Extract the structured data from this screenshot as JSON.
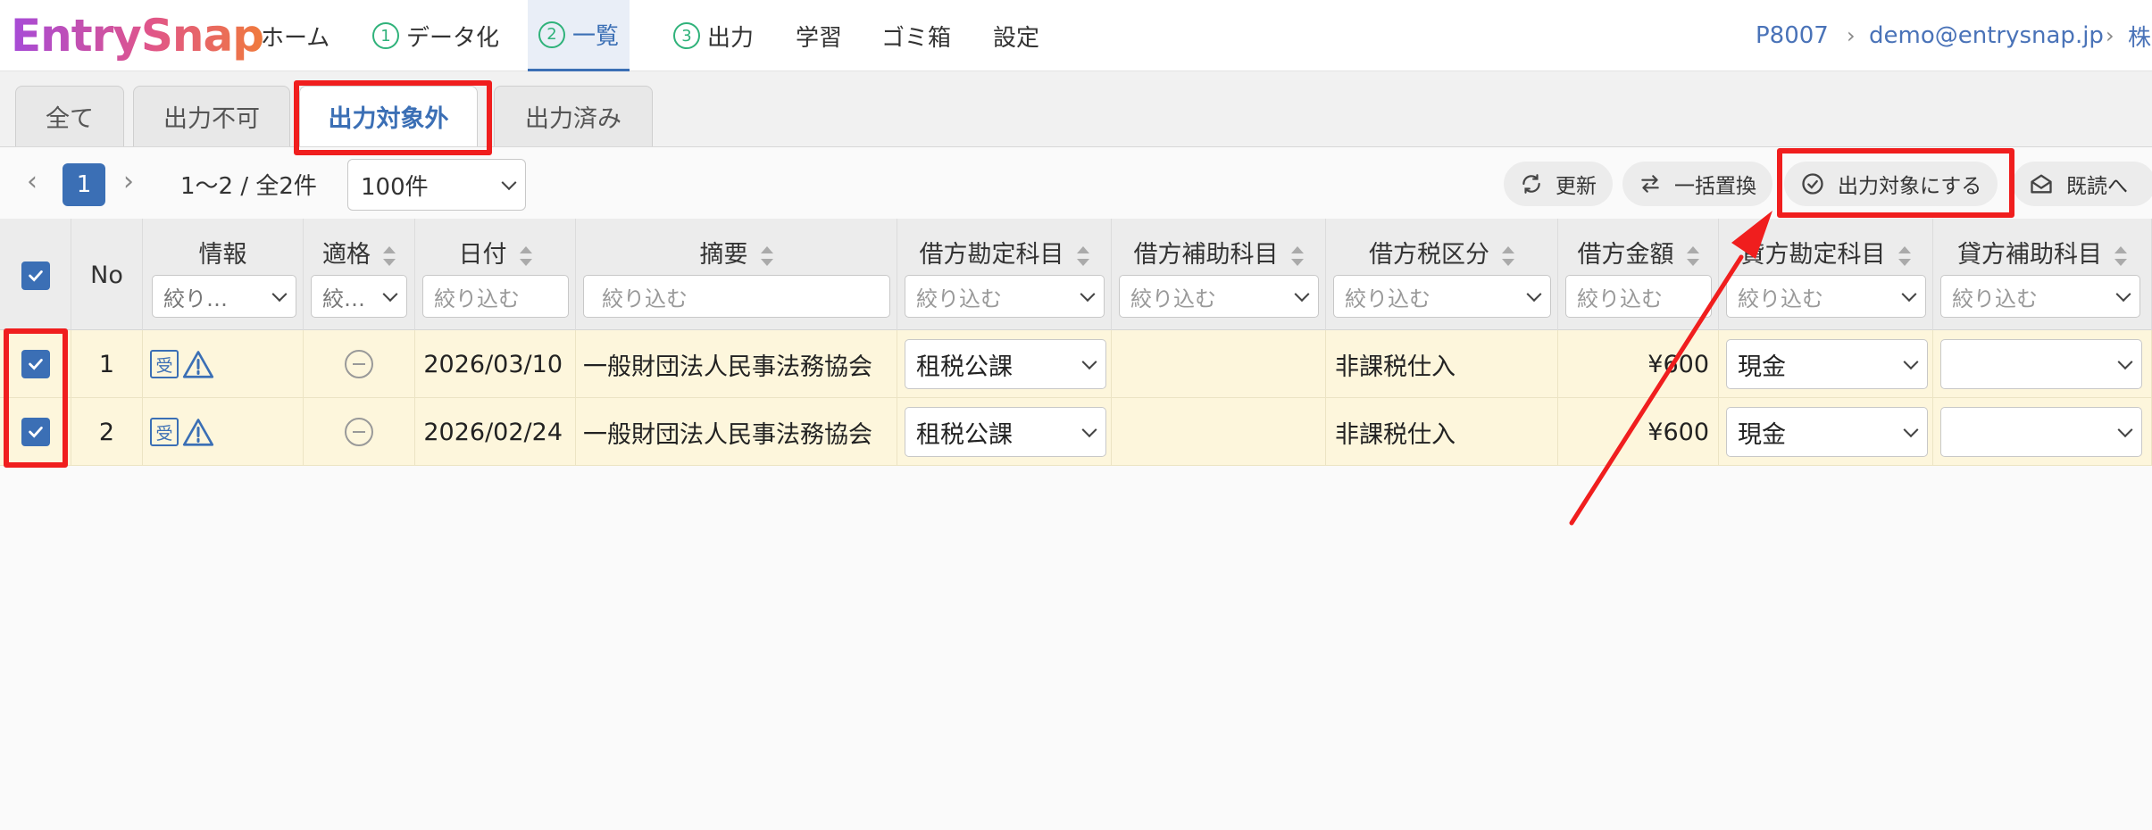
{
  "header": {
    "logo": "EntrySnap",
    "nav": [
      {
        "label": "ホーム",
        "step": ""
      },
      {
        "label": "データ化",
        "step": "1"
      },
      {
        "label": "一覧",
        "step": "2",
        "active": true
      },
      {
        "label": "出力",
        "step": "3"
      },
      {
        "label": "学習",
        "step": ""
      },
      {
        "label": "ゴミ箱",
        "step": ""
      },
      {
        "label": "設定",
        "step": ""
      }
    ],
    "breadcrumb": [
      "P8007",
      "demo@entrysnap.jp",
      "株"
    ]
  },
  "tabs": [
    {
      "label": "全て"
    },
    {
      "label": "出力不可"
    },
    {
      "label": "出力対象外",
      "active": true
    },
    {
      "label": "出力済み"
    }
  ],
  "toolbar": {
    "current_page": "1",
    "range": "1〜2 / 全2件",
    "per_page": "100件",
    "buttons": {
      "refresh": "更新",
      "bulk_replace": "一括置換",
      "mark_output": "出力対象にする",
      "mark_read": "既読へ"
    }
  },
  "table": {
    "columns": {
      "no": "No",
      "info": "情報",
      "eligible": "適格",
      "date": "日付",
      "summary": "摘要",
      "debit_account": "借方勘定科目",
      "debit_sub": "借方補助科目",
      "debit_tax": "借方税区分",
      "debit_amount": "借方金額",
      "credit_account": "貸方勘定科目",
      "credit_sub": "貸方補助科目"
    },
    "filter_placeholder": "絞り込む",
    "filter_short_info": "絞り…",
    "filter_short_eligible": "絞…",
    "rows": [
      {
        "no": "1",
        "badge": "受",
        "date": "2026/03/10",
        "summary": "一般財団法人民事法務協会",
        "debit_account": "租税公課",
        "debit_sub": "",
        "debit_tax": "非課税仕入",
        "debit_amount": "¥600",
        "credit_account": "現金",
        "credit_sub": ""
      },
      {
        "no": "2",
        "badge": "受",
        "date": "2026/02/24",
        "summary": "一般財団法人民事法務協会",
        "debit_account": "租税公課",
        "debit_sub": "",
        "debit_tax": "非課税仕入",
        "debit_amount": "¥600",
        "credit_account": "現金",
        "credit_sub": ""
      }
    ]
  },
  "colors": {
    "accent": "#3b6fb5",
    "annotation": "#f01e1e",
    "row_bg": "#fdf6dc"
  }
}
